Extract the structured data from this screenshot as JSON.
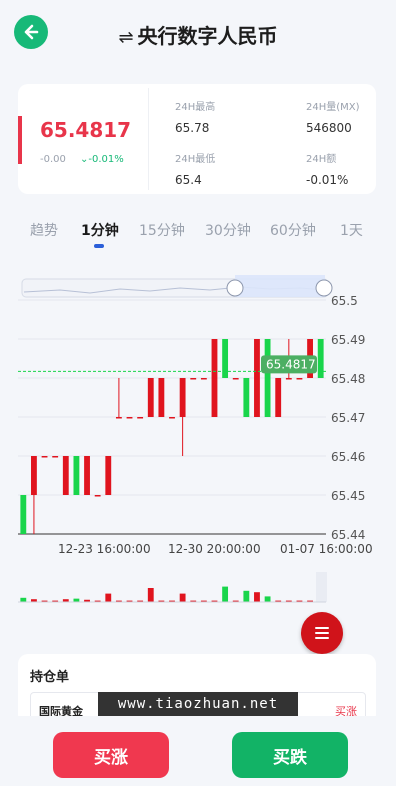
{
  "header": {
    "title": "央行数字人民币",
    "swap_icon": "⇌"
  },
  "quote": {
    "price": "65.4817",
    "change": "-0.00",
    "change_pct": "-0.01%",
    "stats": [
      {
        "label": "24H最高",
        "value": "65.78"
      },
      {
        "label": "24H量(MX)",
        "value": "546800"
      },
      {
        "label": "24H最低",
        "value": "65.4"
      },
      {
        "label": "24H额",
        "value": "-0.01%"
      }
    ]
  },
  "tabs": [
    "趋势",
    "1分钟",
    "15分钟",
    "30分钟",
    "60分钟",
    "1天"
  ],
  "active_tab": "1分钟",
  "chart_data": {
    "type": "candlestick",
    "y_ticks": [
      "65.5",
      "65.49",
      "65.48",
      "65.47",
      "65.46",
      "65.45",
      "65.44"
    ],
    "ylim": [
      65.44,
      65.5
    ],
    "x_ticks": [
      "12-23 16:00:00",
      "12-30 20:00:00",
      "01-07 16:00:00"
    ],
    "last_price_label": "65.4817",
    "last_price": 65.4817,
    "colors": {
      "up": "#e0141e",
      "down": "#19d54b"
    },
    "candles": [
      {
        "o": 65.45,
        "c": 65.44,
        "h": 65.45,
        "l": 65.44,
        "vol": 0.15
      },
      {
        "o": 65.45,
        "c": 65.46,
        "h": 65.46,
        "l": 65.44,
        "vol": 0.1
      },
      {
        "o": 65.46,
        "c": 65.46,
        "h": 65.46,
        "l": 65.46,
        "vol": 0.05
      },
      {
        "o": 65.46,
        "c": 65.46,
        "h": 65.46,
        "l": 65.46,
        "vol": 0.05
      },
      {
        "o": 65.45,
        "c": 65.46,
        "h": 65.46,
        "l": 65.45,
        "vol": 0.1
      },
      {
        "o": 65.46,
        "c": 65.45,
        "h": 65.46,
        "l": 65.45,
        "vol": 0.12
      },
      {
        "o": 65.45,
        "c": 65.46,
        "h": 65.46,
        "l": 65.45,
        "vol": 0.08
      },
      {
        "o": 65.45,
        "c": 65.45,
        "h": 65.45,
        "l": 65.45,
        "vol": 0.05
      },
      {
        "o": 65.45,
        "c": 65.46,
        "h": 65.46,
        "l": 65.45,
        "vol": 0.3
      },
      {
        "o": 65.47,
        "c": 65.47,
        "h": 65.48,
        "l": 65.47,
        "vol": 0.05
      },
      {
        "o": 65.47,
        "c": 65.47,
        "h": 65.47,
        "l": 65.47,
        "vol": 0.05
      },
      {
        "o": 65.47,
        "c": 65.47,
        "h": 65.47,
        "l": 65.47,
        "vol": 0.05
      },
      {
        "o": 65.47,
        "c": 65.48,
        "h": 65.48,
        "l": 65.47,
        "vol": 0.5
      },
      {
        "o": 65.47,
        "c": 65.48,
        "h": 65.48,
        "l": 65.47,
        "vol": 0.05
      },
      {
        "o": 65.47,
        "c": 65.47,
        "h": 65.47,
        "l": 65.47,
        "vol": 0.05
      },
      {
        "o": 65.47,
        "c": 65.48,
        "h": 65.48,
        "l": 65.46,
        "vol": 0.3
      },
      {
        "o": 65.48,
        "c": 65.48,
        "h": 65.48,
        "l": 65.48,
        "vol": 0.05
      },
      {
        "o": 65.48,
        "c": 65.48,
        "h": 65.48,
        "l": 65.48,
        "vol": 0.05
      },
      {
        "o": 65.47,
        "c": 65.49,
        "h": 65.49,
        "l": 65.47,
        "vol": 0.05
      },
      {
        "o": 65.49,
        "c": 65.48,
        "h": 65.49,
        "l": 65.48,
        "vol": 0.55
      },
      {
        "o": 65.48,
        "c": 65.48,
        "h": 65.48,
        "l": 65.48,
        "vol": 0.05
      },
      {
        "o": 65.48,
        "c": 65.47,
        "h": 65.48,
        "l": 65.47,
        "vol": 0.4
      },
      {
        "o": 65.47,
        "c": 65.49,
        "h": 65.49,
        "l": 65.47,
        "vol": 0.35
      },
      {
        "o": 65.49,
        "c": 65.47,
        "h": 65.49,
        "l": 65.47,
        "vol": 0.2
      },
      {
        "o": 65.47,
        "c": 65.48,
        "h": 65.48,
        "l": 65.47,
        "vol": 0.05
      },
      {
        "o": 65.48,
        "c": 65.48,
        "h": 65.49,
        "l": 65.48,
        "vol": 0.05
      },
      {
        "o": 65.48,
        "c": 65.48,
        "h": 65.48,
        "l": 65.48,
        "vol": 0.05
      },
      {
        "o": 65.48,
        "c": 65.49,
        "h": 65.49,
        "l": 65.48,
        "vol": 0.05
      },
      {
        "o": 65.49,
        "c": 65.48,
        "h": 65.49,
        "l": 65.48,
        "vol": 0.05
      }
    ]
  },
  "positions": {
    "title": "持仓单",
    "rows": [
      {
        "name": "国际黄金",
        "direction": "买涨"
      }
    ]
  },
  "watermark": "www.tiaozhuan.net",
  "actions": {
    "buy_up": "买涨",
    "buy_down": "买跌"
  }
}
